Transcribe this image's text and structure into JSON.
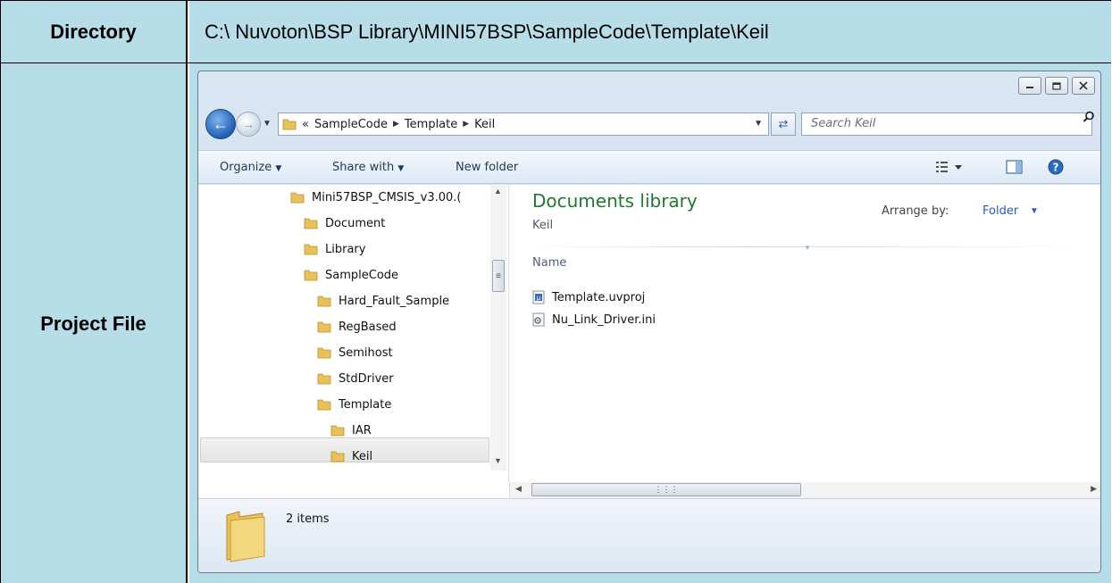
{
  "table": {
    "directory_label": "Directory",
    "directory_value": "C:\\ Nuvoton\\BSP Library\\MINI57BSP\\SampleCode\\Template\\Keil",
    "project_label": "Project File"
  },
  "explorer": {
    "window_buttons": [
      "minimize",
      "maximize",
      "close"
    ],
    "address": {
      "overflow_marker": "«",
      "crumbs": [
        "SampleCode",
        "Template",
        "Keil"
      ]
    },
    "search_placeholder": "Search Keil",
    "toolbar": {
      "organize": "Organize",
      "share_with": "Share with",
      "new_folder": "New folder"
    },
    "tree": [
      {
        "label": "Mini57BSP_CMSIS_v3.00.(",
        "depth": 0
      },
      {
        "label": "Document",
        "depth": 1
      },
      {
        "label": "Library",
        "depth": 1
      },
      {
        "label": "SampleCode",
        "depth": 1
      },
      {
        "label": "Hard_Fault_Sample",
        "depth": 2
      },
      {
        "label": "RegBased",
        "depth": 2
      },
      {
        "label": "Semihost",
        "depth": 2
      },
      {
        "label": "StdDriver",
        "depth": 2
      },
      {
        "label": "Template",
        "depth": 2
      },
      {
        "label": "IAR",
        "depth": 3
      },
      {
        "label": "Keil",
        "depth": 3,
        "selected": true
      }
    ],
    "pane": {
      "title": "Documents library",
      "subtitle": "Keil",
      "arrange_label": "Arrange by:",
      "arrange_value": "Folder",
      "column_name": "Name",
      "files": [
        {
          "name": "Template.uvproj",
          "icon": "uvproj-icon"
        },
        {
          "name": "Nu_Link_Driver.ini",
          "icon": "ini-settings-icon"
        }
      ]
    },
    "status": {
      "item_count": "2 items"
    },
    "colors": {
      "cell_background": "#b6dde8",
      "library_title": "#1e7a2e",
      "link_blue": "#1f5fbd"
    }
  }
}
